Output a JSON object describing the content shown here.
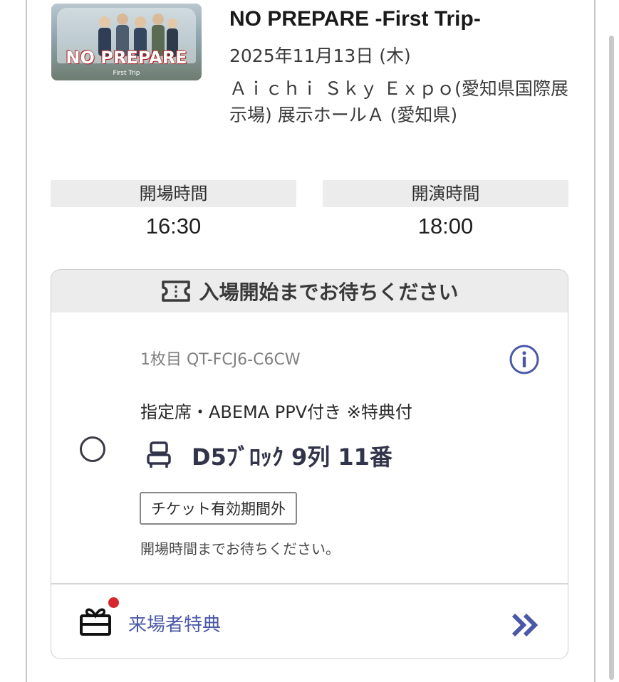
{
  "event": {
    "thumbnail_logo": "NO PREPARE",
    "thumbnail_sub": "First Trip",
    "title": "NO PREPARE -First Trip-",
    "date": "2025年11月13日 (木)",
    "venue": "Ａｉｃｈｉ Ｓｋｙ Ｅｘｐｏ(愛知県国際展示場) 展示ホールＡ (愛知県)"
  },
  "times": {
    "open_label": "開場時間",
    "open_value": "16:30",
    "start_label": "開演時間",
    "start_value": "18:00"
  },
  "ticket": {
    "status_header": "入場開始までお待ちください",
    "ticket_number": "1枚目 QT-FCJ6-C6CW",
    "seat_type": "指定席・ABEMA PPV付き ※特典付",
    "seat": "D5ﾌﾞﾛｯｸ 9列 11番",
    "validity_badge": "チケット有効期間外",
    "wait_note": "開場時間までお待ちください。",
    "bonus_label": "来場者特典"
  },
  "colors": {
    "accent": "#4b58a8",
    "notification_dot": "#d7262c",
    "header_bg": "#ececec"
  },
  "icons": [
    "ticket-icon",
    "info-icon",
    "seat-icon",
    "gift-icon",
    "double-chevron-right-icon"
  ]
}
